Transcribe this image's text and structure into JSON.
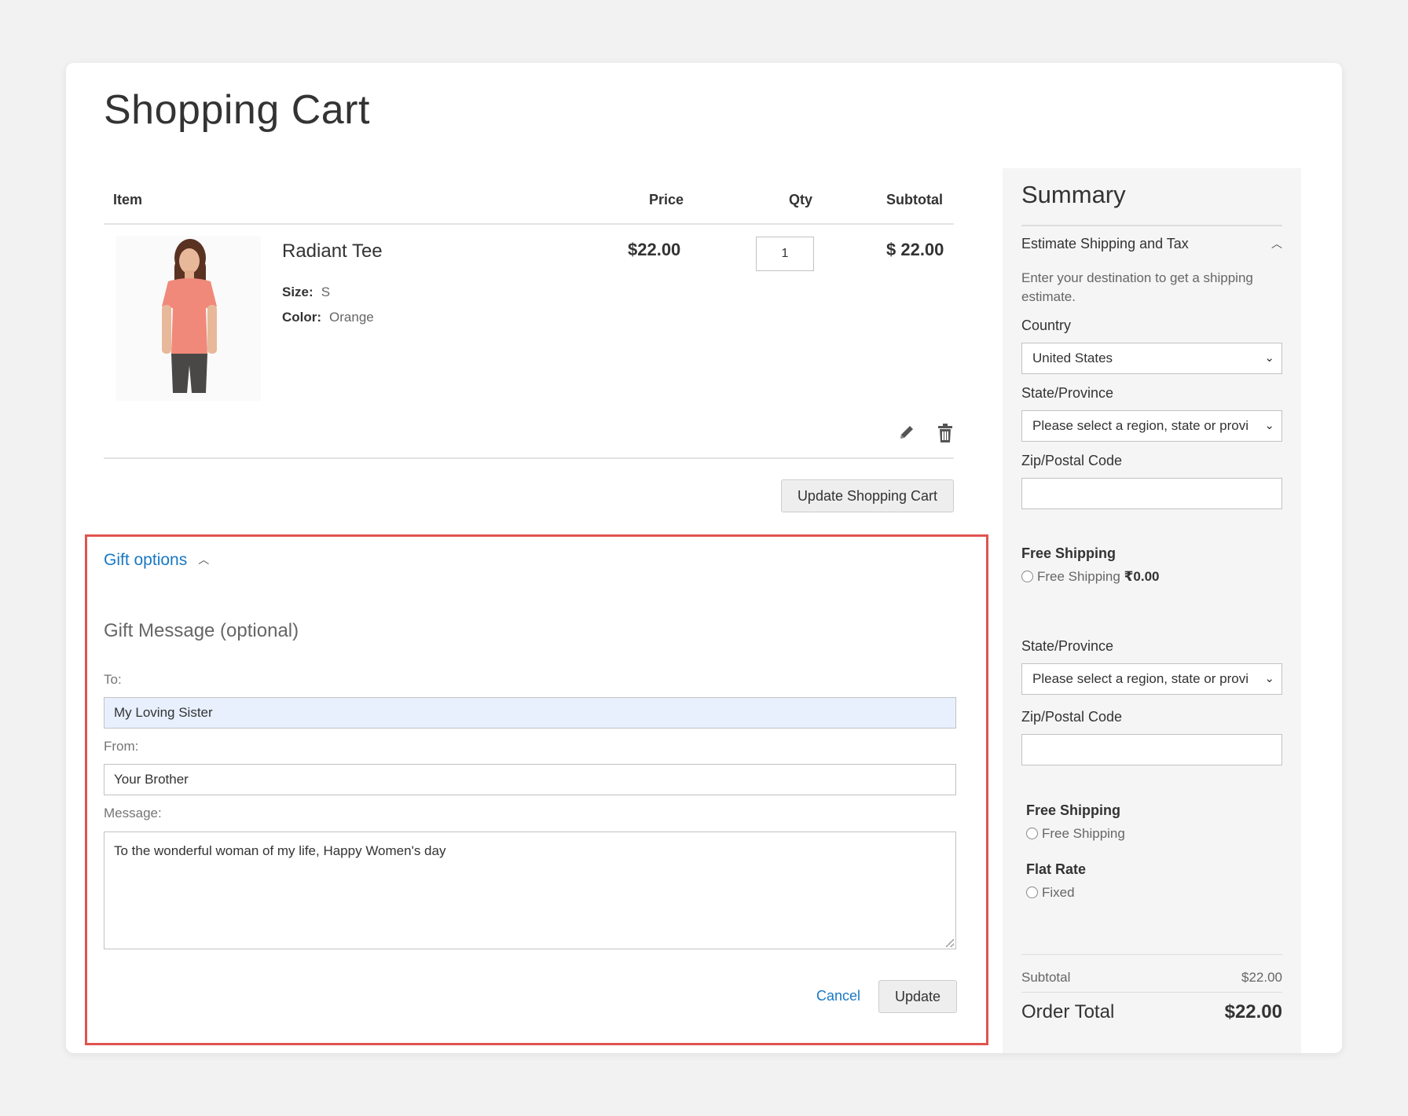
{
  "page": {
    "title": "Shopping Cart"
  },
  "cart": {
    "columns": {
      "item": "Item",
      "price": "Price",
      "qty": "Qty",
      "subtotal": "Subtotal"
    },
    "items": [
      {
        "name": "Radiant Tee",
        "size_label": "Size:",
        "size": "S",
        "color_label": "Color:",
        "color": "Orange",
        "price": "$22.00",
        "qty": "1",
        "subtotal": "$ 22.00"
      }
    ],
    "update_button": "Update Shopping Cart"
  },
  "gift": {
    "toggle_label": "Gift options",
    "heading": "Gift Message (optional)",
    "to_label": "To:",
    "to_value": "My Loving Sister",
    "from_label": "From:",
    "from_value": "Your Brother",
    "message_label": "Message:",
    "message_value": "To the wonderful woman of my life, Happy Women's day",
    "cancel": "Cancel",
    "update": "Update",
    "highlight_color": "#e0544f"
  },
  "summary": {
    "title": "Summary",
    "estimate_title": "Estimate Shipping and Tax",
    "estimate_text": "Enter your destination to get a shipping estimate.",
    "country_label": "Country",
    "country_value": "United States",
    "state_label": "State/Province",
    "state_placeholder": "Please select a region, state or provi",
    "zip_label": "Zip/Postal Code",
    "free_shipping_title": "Free Shipping",
    "free_shipping_option": "Free Shipping",
    "free_shipping_price": "₹0.00",
    "state_label_2": "State/Province",
    "state_placeholder_2": "Please select a region, state or provi",
    "zip_label_2": "Zip/Postal Code",
    "free_shipping_title_2": "Free Shipping",
    "free_shipping_option_2": "Free Shipping",
    "flat_rate_title": "Flat Rate",
    "flat_rate_option": "Fixed",
    "subtotal_label": "Subtotal",
    "subtotal_value": "$22.00",
    "order_total_label": "Order Total",
    "order_total_value": "$22.00"
  },
  "colors": {
    "link": "#1979c3",
    "autofill": "#e8f0fe",
    "product": "#f0897a"
  }
}
